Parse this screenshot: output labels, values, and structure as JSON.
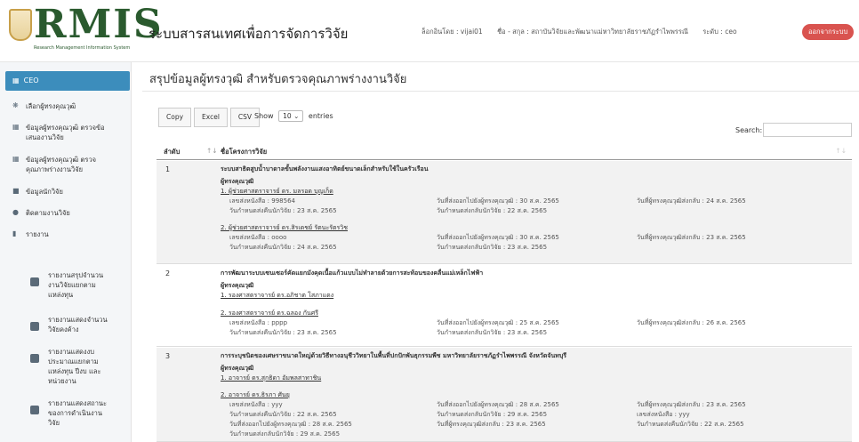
{
  "header": {
    "logo_text": "RMIS",
    "logo_subtext": "Research Management Information System",
    "app_title": "ระบบสารสนเทศเพื่อการจัดการวิจัย",
    "login_label": "ล็อกอินโดย : vijai01",
    "name_label": "ชื่อ - สกุล : สถาบันวิจัยและพัฒนาแม่หาวิทยาลัยราชภัฏรำไพพรรณี",
    "role_label": "ระดับ : ceo",
    "logout_label": "ออกจากระบบ"
  },
  "sidebar": {
    "active": "CEO",
    "items": [
      {
        "label": "เลือกผู้ทรงคุณวุฒิ"
      },
      {
        "label": "ข้อมูลผู้ทรงคุณวุฒิ ตรวจข้อเสนองานวิจัย"
      },
      {
        "label": "ข้อมูลผู้ทรงคุณวุฒิ ตรวจคุณภาพร่างงานวิจัย"
      },
      {
        "label": "ข้อมูลนักวิจัย"
      },
      {
        "label": "ติดตามงานวิจัย"
      },
      {
        "label": "รายงาน"
      }
    ],
    "subitems": [
      {
        "label": "รายงานสรุปจำนวนงานวิจัยแยกตามแหล่งทุน"
      },
      {
        "label": "รายงานแสดงจำนวนวิจัยคงค้าง"
      },
      {
        "label": "รายงานแสดงงบประมาณแยกตามแหล่งทุน ปีงบ และหน่วยงาน"
      },
      {
        "label": "รายงานแสดงสถานะของการดำเนินงานวิจัย"
      }
    ]
  },
  "main": {
    "page_title": "สรุปข้อมูลผู้ทรงวุฒิ สำหรับตรวจคุณภาพร่างงานวิจัย",
    "buttons": {
      "copy": "Copy",
      "excel": "Excel",
      "csv": "CSV"
    },
    "show_label": "Show",
    "entries_value": "10",
    "entries_label": "entries",
    "search_label": "Search:",
    "columns": {
      "no": "ลำดับ",
      "project": "ชื่อโครงการวิจัย"
    },
    "group_label": "ผู้ทรงคุณวุฒิ",
    "rows": [
      {
        "no": "1",
        "title": "ระบบสาธิตสูบน้ำบาดาลขั้นพลังงานแสงอาทิตย์ขนาดเล็กสำหรับใช้ในครัวเรือน",
        "reviewers": [
          {
            "name": "1. ผู้ช่วยศาสตราจารย์ ดร. มลรอด บุญเก็ด",
            "doc": "เลขส่งหนังสือ : 998564",
            "due_back": "วันกำหนดส่งคืนนักวิจัย : 23 ส.ค. 2565",
            "sent": "วันที่ส่งออกไปยังผู้ทรงคุณวุฒิ : 30 ส.ค. 2565",
            "due_send": "วันกำหนดส่งกลับนักวิจัย : 22 ส.ค. 2565",
            "returned": "วันที่ผู้ทรงคุณวุฒิส่งกลับ : 24 ส.ค. 2565"
          },
          {
            "name": "2. ผู้ช่วยศาสตราจารย์ ดร.สิรเดชย์ รัตนะรัตรวิช",
            "doc": "เลขส่งหนังสือ : oooo",
            "due_back": "วันกำหนดส่งคืนนักวิจัย : 24 ส.ค. 2565",
            "sent": "วันที่ส่งออกไปยังผู้ทรงคุณวุฒิ : 30 ส.ค. 2565",
            "due_send": "วันกำหนดส่งกลับนักวิจัย : 23 ส.ค. 2565",
            "returned": "วันที่ผู้ทรงคุณวุฒิส่งกลับ : 23 ส.ค. 2565"
          }
        ]
      },
      {
        "no": "2",
        "title": "การพัฒนาระบบเซนเซอร์คัดแยกมังคุดเนื้อแก้วแบบไม่ทำลายด้วยการสะท้อนของคลื่นแม่เหล็กไฟฟ้า",
        "reviewers": [
          {
            "name": "1. รองศาสตราจารย์ ดร.อภิชาต โสภาแดง"
          },
          {
            "name": "2. รองศาสตราจารย์ ดร.ฉลอง กันศรี",
            "doc": "เลขส่งหนังสือ : pppp",
            "due_back": "วันกำหนดส่งคืนนักวิจัย : 23 ส.ค. 2565",
            "sent": "วันที่ส่งออกไปยังผู้ทรงคุณวุฒิ : 25 ส.ค. 2565",
            "due_send": "วันกำหนดส่งกลับนักวิจัย : 23 ส.ค. 2565",
            "returned": "วันที่ผู้ทรงคุณวุฒิส่งกลับ : 26 ส.ค. 2565"
          }
        ]
      },
      {
        "no": "3",
        "title": "การระบุชนิดของเศษราขนาดใหญ่ด้วยวิธีทางอนุชีววิทยาในพื้นที่ปกปักพันธุกรรมพืช มหาวิทยาลัยราชภัฏรำไพพรรณี จังหวัดจันทบุรี",
        "reviewers": [
          {
            "name": "1. อาจารย์ ดร.สุกธิดา อัมพลสาทาชิน"
          },
          {
            "name": "2. อาจารย์ ดร.ธิรภา ศันยุ",
            "doc": "เลขส่งหนังสือ : yyy",
            "due_back": "วันกำหนดส่งคืนนักวิจัย : 22 ส.ค. 2565",
            "sent": "วันที่ส่งออกไปยังผู้ทรงคุณวุฒิ : 28 ส.ค. 2565",
            "due_send": "วันกำหนดส่งกลับนักวิจัย : 29 ส.ค. 2565",
            "returned": "วันที่ผู้ทรงคุณวุฒิส่งกลับ : 23 ส.ค. 2565",
            "extra_left_1": "วันที่ส่งออกไปยังผู้ทรงคุณวุฒิ : 28 ส.ค. 2565",
            "extra_left_2": "วันกำหนดส่งกลับนักวิจัย : 29 ส.ค. 2565",
            "extra_mid": "วันที่ผู้ทรงคุณวุฒิส่งกลับ : 23 ส.ค. 2565",
            "extra_right_1": "เลขส่งหนังสือ : yyy",
            "extra_right_2": "วันกำหนดส่งคืนนักวิจัย : 22 ส.ค. 2565"
          }
        ]
      }
    ]
  },
  "colors": {
    "accent": "#3c8dbc",
    "logout": "#d9534f",
    "logo": "#2a5a2e"
  }
}
